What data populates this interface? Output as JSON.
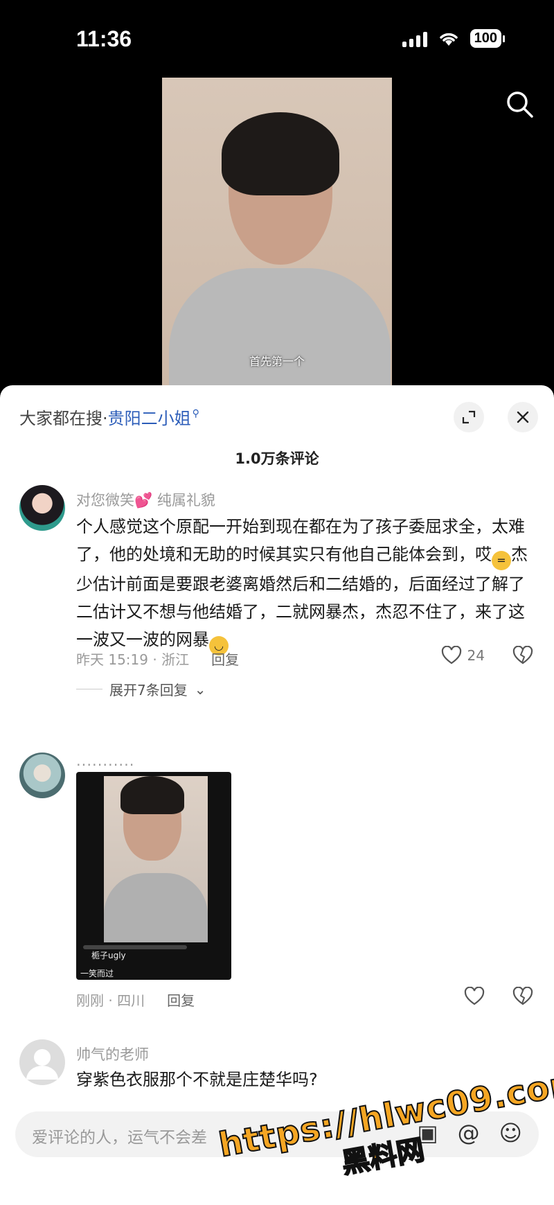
{
  "status_bar": {
    "time": "11:36",
    "battery": "100"
  },
  "video": {
    "caption": "首先第一个"
  },
  "header": {
    "search_label": "大家都在搜·",
    "search_term": "贵阳二小姐",
    "comment_count": "1.0万条评论"
  },
  "comments": [
    {
      "username": "对您微笑💕 纯属礼貌",
      "text_a": "个人感觉这个原配一开始到现在都在为了孩子委屈求全，太难了，他的处境和无助的时候其实只有他自己能体会到，哎",
      "text_b": "杰少估计前面是要跟老婆离婚然后和二结婚的，后面经过了解了二估计又不想与他结婚了，二就网暴杰，杰忍不住了，来了这一波又一波的网暴",
      "time_location": "昨天 15:19 · 浙江",
      "reply_label": "回复",
      "likes": "24",
      "expand_label": "展开7条回复"
    },
    {
      "username": "...........",
      "thumb_text_a": "栀子ugly",
      "thumb_text_b": "一笑而过",
      "time_location": "刚刚 · 四川",
      "reply_label": "回复"
    },
    {
      "username": "帅气的老师",
      "text": "穿紫色衣服那个不就是庄楚华吗?"
    }
  ],
  "input": {
    "placeholder": "爱评论的人，运气不会差"
  },
  "watermark": {
    "url": "https://hlwc09.com",
    "name": "黑料网"
  },
  "colors": {
    "link": "#2c5db9",
    "watermark": "#f5a623"
  }
}
